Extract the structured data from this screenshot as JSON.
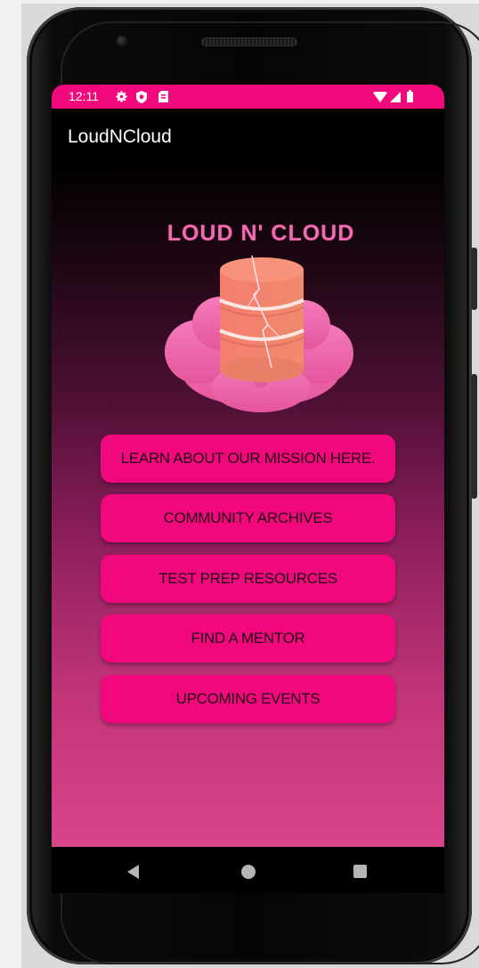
{
  "status_bar": {
    "time": "12:11",
    "left_icons": [
      "gear-icon",
      "shield-icon",
      "sim-card-icon"
    ],
    "right_icons": [
      "wifi-icon",
      "signal-icon",
      "battery-icon"
    ],
    "color": "#f2087d"
  },
  "app_bar": {
    "title": "LoudNCloud"
  },
  "logo": {
    "text": "LOUD N' CLOUD"
  },
  "menu": {
    "buttons": [
      {
        "label": "LEARN ABOUT OUR MISSION HERE."
      },
      {
        "label": "COMMUNITY ARCHIVES"
      },
      {
        "label": "TEST PREP RESOURCES"
      },
      {
        "label": "FIND A MENTOR"
      },
      {
        "label": "UPCOMING EVENTS"
      }
    ],
    "button_color": "#f2087d"
  },
  "nav_bar": {
    "icons": [
      "back-icon",
      "home-icon",
      "recents-icon"
    ]
  }
}
